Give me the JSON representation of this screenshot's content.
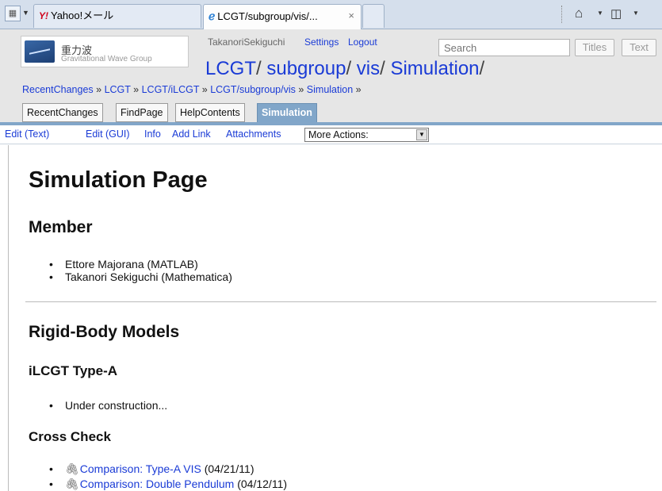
{
  "browser": {
    "tabs": [
      {
        "label": "Yahoo!メール",
        "logo": "Y!"
      },
      {
        "label": "LCGT/subgroup/vis/...",
        "close": "×"
      }
    ]
  },
  "wiki": {
    "logo_title": "重力波",
    "logo_subtitle": "Gravitational Wave Group",
    "user": "TakanoriSekiguchi",
    "settings_label": "Settings",
    "logout_label": "Logout",
    "search_placeholder": "Search",
    "titles_button": "Titles",
    "text_button": "Text",
    "page_path": [
      "LCGT",
      "subgroup",
      "vis",
      "Simulation"
    ],
    "breadcrumb": [
      "RecentChanges",
      "LCGT",
      "LCGT/iLCGT",
      "LCGT/subgroup/vis",
      "Simulation"
    ],
    "nav_tabs": [
      "RecentChanges",
      "FindPage",
      "HelpContents",
      "Simulation"
    ],
    "edit_links": [
      "Edit (Text)",
      "Edit (GUI)",
      "Info",
      "Add Link",
      "Attachments"
    ],
    "more_actions": "More Actions:"
  },
  "content": {
    "title": "Simulation Page",
    "member_heading": "Member",
    "members": [
      "Ettore Majorana (MATLAB)",
      "Takanori Sekiguchi (Mathematica)"
    ],
    "rigid_heading": "Rigid-Body Models",
    "ilcgt_heading": "iLCGT Type-A",
    "ilcgt_items": [
      "Under construction..."
    ],
    "crosscheck_heading": "Cross Check",
    "crosscheck_items": [
      {
        "link": "Comparison: Type-A VIS",
        "date": " (04/21/11)"
      },
      {
        "link": "Comparison: Double Pendulum",
        "date": " (04/12/11)"
      }
    ]
  }
}
